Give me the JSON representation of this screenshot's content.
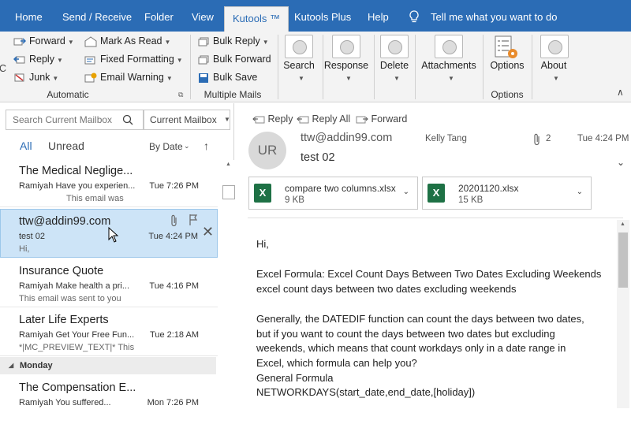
{
  "tabs": [
    {
      "label": "Home",
      "active": false
    },
    {
      "label": "Send / Receive",
      "active": false
    },
    {
      "label": "Folder",
      "active": false
    },
    {
      "label": "View",
      "active": false
    },
    {
      "label": "Kutools ™",
      "active": true
    },
    {
      "label": "Kutools Plus",
      "active": false
    },
    {
      "label": "Help",
      "active": false
    }
  ],
  "tell_me": "Tell me what you want to do",
  "ribbon": {
    "left_c": "C",
    "automatic": {
      "items": [
        "Forward",
        "Reply",
        "Junk",
        "Mark As Read",
        "Fixed Formatting",
        "Email Warning"
      ],
      "label": "Automatic"
    },
    "multiple": {
      "items": [
        "Bulk Reply",
        "Bulk Forward",
        "Bulk Save"
      ],
      "label": "Multiple Mails"
    },
    "big": {
      "search": "Search",
      "response": "Response",
      "delete": "Delete",
      "attachments": "Attachments",
      "options": "Options",
      "about": "About"
    },
    "options_group_label": "Options"
  },
  "left": {
    "search_placeholder": "Search Current Mailbox",
    "scope": "Current Mailbox",
    "filter_all": "All",
    "filter_unread": "Unread",
    "sort": "By Date",
    "messages": [
      {
        "from": "The Medical Neglige...",
        "subject": "Ramiyah Have you experien...",
        "time": "Tue 7:26 PM",
        "preview": "This email was"
      },
      {
        "from": "ttw@addin99.com",
        "subject": "test 02",
        "time": "Tue 4:24 PM",
        "preview": "Hi,"
      },
      {
        "from": "Insurance Quote",
        "subject": "Ramiyah Make health a pri...",
        "time": "Tue 4:16 PM",
        "preview": "This email was sent to you"
      },
      {
        "from": "Later Life Experts",
        "subject": "Ramiyah Get Your Free Fun...",
        "time": "Tue 2:18 AM",
        "preview": "*|MC_PREVIEW_TEXT|*  This"
      },
      {
        "from": "The Compensation E...",
        "subject": "Ramiyah You suffered...",
        "time": "Mon 7:26 PM",
        "preview": ""
      }
    ],
    "group_header": "Monday"
  },
  "reading": {
    "actions": {
      "reply": "Reply",
      "reply_all": "Reply All",
      "forward": "Forward"
    },
    "avatar": "UR",
    "from": "ttw@addin99.com",
    "to": "Kelly Tang",
    "attach_count": "2",
    "time": "Tue 4:24 PM",
    "subject": "test 02",
    "attachments": [
      {
        "name": "compare two columns.xlsx",
        "size": "9 KB"
      },
      {
        "name": "20201120.xlsx",
        "size": "15 KB"
      }
    ],
    "body_lines": [
      "Hi,",
      "Excel Formula: Excel Count Days Between Two Dates Excluding Weekends",
      "excel count days between two dates excluding weekends",
      "Generally, the DATEDIF function can count the days between two dates,",
      "but if you want to count the days between two dates but excluding",
      "weekends, which means that count workdays only in a date range in",
      "Excel, which formula can help you?",
      "General Formula",
      "NETWORKDAYS(start_date,end_date,[holiday])"
    ]
  },
  "colors": {
    "accent": "#2b6cb5",
    "selected": "#cde4f7",
    "excel": "#1e7145"
  }
}
